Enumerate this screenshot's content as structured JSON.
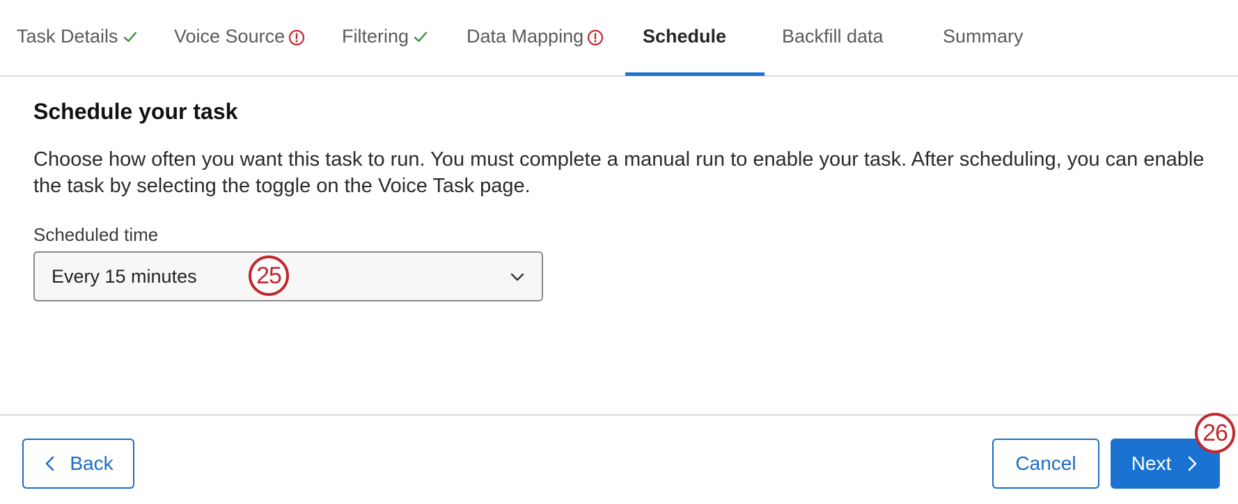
{
  "tabs": [
    {
      "label": "Task Details",
      "status": "complete"
    },
    {
      "label": "Voice Source",
      "status": "error"
    },
    {
      "label": "Filtering",
      "status": "complete"
    },
    {
      "label": "Data Mapping",
      "status": "error"
    },
    {
      "label": "Schedule",
      "status": "active"
    },
    {
      "label": "Backfill data",
      "status": "pending"
    },
    {
      "label": "Summary",
      "status": "pending"
    }
  ],
  "main": {
    "heading": "Schedule your task",
    "description": "Choose how often you want this task to run. You must complete a manual run to enable your task. After scheduling, you can enable the task by selecting the toggle on the Voice Task page.",
    "scheduled_time": {
      "label": "Scheduled time",
      "value": "Every 15 minutes"
    }
  },
  "annotations": {
    "step_25": "25",
    "step_26": "26"
  },
  "footer": {
    "back_label": "Back",
    "cancel_label": "Cancel",
    "next_label": "Next"
  },
  "colors": {
    "accent": "#1a73d1",
    "success": "#2e8b2e",
    "error": "#c1272d",
    "annotation": "#c1272d"
  },
  "icons": {
    "complete": "check-icon",
    "error": "alert-circle-icon",
    "dropdown": "chevron-down-icon",
    "back": "chevron-left-icon",
    "next": "chevron-right-icon"
  }
}
